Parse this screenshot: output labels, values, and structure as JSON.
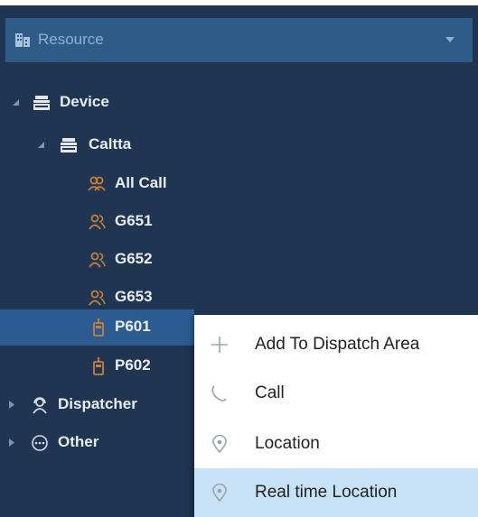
{
  "header": {
    "label": "Resource",
    "icon": "building-icon",
    "caret_icon": "dropdown-caret-icon"
  },
  "tree": {
    "device": {
      "label": "Device",
      "icon": "device-icon"
    },
    "caltta": {
      "label": "Caltta",
      "icon": "device-icon"
    },
    "all_call": {
      "label": "All Call",
      "icon": "group-call-icon"
    },
    "g651": {
      "label": "G651",
      "icon": "group-icon"
    },
    "g652": {
      "label": "G652",
      "icon": "group-icon"
    },
    "g653": {
      "label": "G653",
      "icon": "group-icon"
    },
    "p601": {
      "label": "P601",
      "icon": "radio-icon",
      "selected": true
    },
    "p602": {
      "label": "P602",
      "icon": "radio-icon"
    },
    "dispatcher": {
      "label": "Dispatcher",
      "icon": "dispatcher-icon"
    },
    "other": {
      "label": "Other",
      "icon": "more-icon"
    }
  },
  "context_menu": {
    "items": [
      {
        "label": "Add To Dispatch Area",
        "icon": "plus-icon"
      },
      {
        "label": "Call",
        "icon": "phone-icon"
      },
      {
        "label": "Location",
        "icon": "location-pin-icon"
      },
      {
        "label": "Real time Location",
        "icon": "location-pin-icon",
        "highlighted": true
      }
    ]
  },
  "colors": {
    "panel_bg": "#1f3552",
    "header_bg": "#2f5b89",
    "selected_bg": "#2b5b91",
    "menu_highlight": "#c7e2f7",
    "icon_orange": "#c7813a"
  }
}
